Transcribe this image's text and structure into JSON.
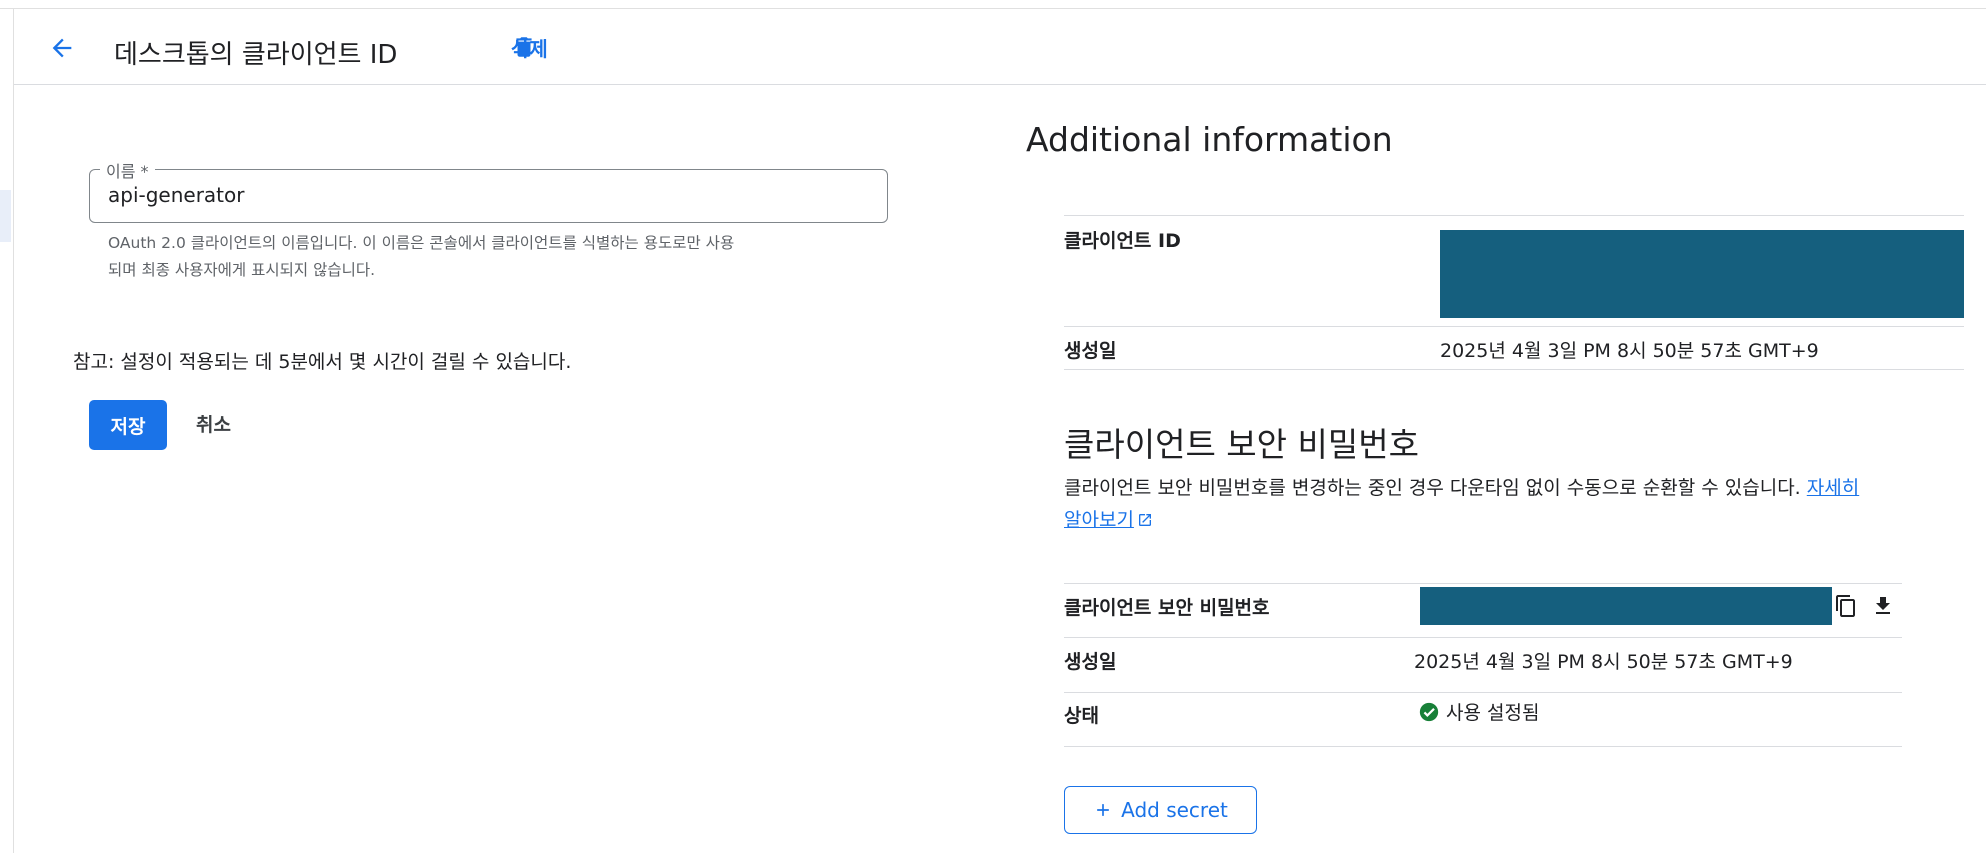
{
  "header": {
    "title": "데스크톱의 클라이언트 ID",
    "delete_label": "삭제"
  },
  "form": {
    "name_label": "이름 *",
    "name_value": "api-generator",
    "hint_line1": "OAuth 2.0 클라이언트의 이름입니다. 이 이름은 콘솔에서 클라이언트를 식별하는 용도로만 사용",
    "hint_line2": "되며 최종 사용자에게 표시되지 않습니다.",
    "note": "참고: 설정이 적용되는 데 5분에서 몇 시간이 걸릴 수 있습니다.",
    "save_label": "저장",
    "cancel_label": "취소"
  },
  "additional": {
    "title": "Additional information",
    "client_id_label": "클라이언트 ID",
    "created_label": "생성일",
    "created_value": "2025년 4월 3일 PM 8시 50분 57초 GMT+9"
  },
  "secret": {
    "title": "클라이언트 보안 비밀번호",
    "description": "클라이언트 보안 비밀번호를 변경하는 중인 경우 다운타임 없이 수동으로 순환할 수 있습니다.",
    "learn_more_1": "자세히",
    "learn_more_2": "알아보기",
    "secret_label": "클라이언트 보안 비밀번호",
    "created_label": "생성일",
    "created_value": "2025년 4월 3일 PM 8시 50분 57초 GMT+9",
    "status_label": "상태",
    "status_value": "사용 설정됨",
    "add_label": "Add secret"
  },
  "colors": {
    "accent": "#1a73e8",
    "redaction": "#155f7e",
    "success": "#188038"
  },
  "icons": {
    "back": "arrow-back-icon",
    "delete": "trash-icon",
    "copy": "copy-icon",
    "download": "download-icon",
    "status": "check-circle-icon",
    "add": "plus-icon",
    "external": "open-in-new-icon"
  }
}
